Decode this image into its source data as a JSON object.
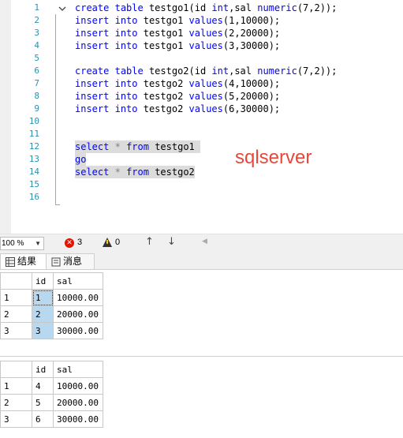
{
  "editor": {
    "line_numbers": [
      "1",
      "2",
      "3",
      "4",
      "5",
      "6",
      "7",
      "8",
      "9",
      "10",
      "11",
      "12",
      "13",
      "14",
      "15",
      "16"
    ],
    "annotation": "sqlserver"
  },
  "toolbar": {
    "zoom": "100 %",
    "error_count": "3",
    "warning_count": "0"
  },
  "tabs": {
    "results": "结果",
    "messages": "消息"
  },
  "results": {
    "grid1": {
      "columns": [
        "id",
        "sal"
      ],
      "rows": [
        {
          "n": "1",
          "id": "1",
          "sal": "10000.00"
        },
        {
          "n": "2",
          "id": "2",
          "sal": "20000.00"
        },
        {
          "n": "3",
          "id": "3",
          "sal": "30000.00"
        }
      ]
    },
    "grid2": {
      "columns": [
        "id",
        "sal"
      ],
      "rows": [
        {
          "n": "1",
          "id": "4",
          "sal": "10000.00"
        },
        {
          "n": "2",
          "id": "5",
          "sal": "20000.00"
        },
        {
          "n": "3",
          "id": "6",
          "sal": "30000.00"
        }
      ]
    }
  },
  "colors": {
    "keyword": "#0000ff",
    "function": "#ff00ff",
    "annotation": "#e8473a",
    "selection": "#dcdcdc",
    "highlight_cell": "#b8d8f0"
  }
}
